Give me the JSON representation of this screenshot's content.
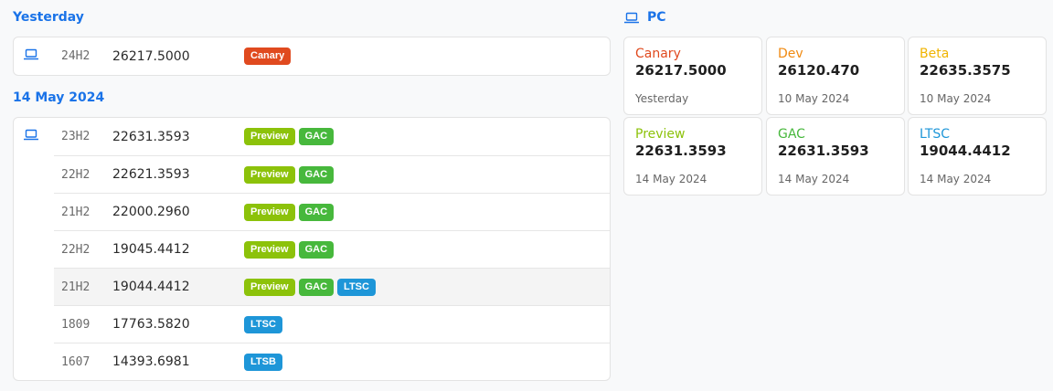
{
  "colors": {
    "accent": "#1a73e8",
    "canary": "#e04a1f",
    "dev": "#f08a11",
    "beta": "#f0b400",
    "preview": "#8cc20a",
    "gac": "#47b83c",
    "ltsc": "#1e96d8"
  },
  "sections": [
    {
      "heading": "Yesterday",
      "rows": [
        {
          "icon": "laptop-icon",
          "version": "24H2",
          "build": "26217.5000",
          "badges": [
            "Canary"
          ]
        }
      ]
    },
    {
      "heading": "14 May 2024",
      "rows": [
        {
          "icon": "laptop-icon",
          "version": "23H2",
          "build": "22631.3593",
          "badges": [
            "Preview",
            "GAC"
          ]
        },
        {
          "version": "22H2",
          "build": "22621.3593",
          "badges": [
            "Preview",
            "GAC"
          ]
        },
        {
          "version": "21H2",
          "build": "22000.2960",
          "badges": [
            "Preview",
            "GAC"
          ]
        },
        {
          "version": "22H2",
          "build": "19045.4412",
          "badges": [
            "Preview",
            "GAC"
          ]
        },
        {
          "version": "21H2",
          "build": "19044.4412",
          "badges": [
            "Preview",
            "GAC",
            "LTSC"
          ]
        },
        {
          "version": "1809",
          "build": "17763.5820",
          "badges": [
            "LTSC"
          ]
        },
        {
          "version": "1607",
          "build": "14393.6981",
          "badges": [
            "LTSB"
          ]
        }
      ]
    }
  ],
  "pc": {
    "heading": "PC",
    "icon": "laptop-icon",
    "tiles": [
      {
        "channel": "Canary",
        "build": "26217.5000",
        "date": "Yesterday",
        "color": "#e04a1f"
      },
      {
        "channel": "Dev",
        "build": "26120.470",
        "date": "10 May 2024",
        "color": "#f08a11"
      },
      {
        "channel": "Beta",
        "build": "22635.3575",
        "date": "10 May 2024",
        "color": "#f0b400"
      },
      {
        "channel": "Preview",
        "build": "22631.3593",
        "date": "14 May 2024",
        "color": "#8cc20a"
      },
      {
        "channel": "GAC",
        "build": "22631.3593",
        "date": "14 May 2024",
        "color": "#47b83c"
      },
      {
        "channel": "LTSC",
        "build": "19044.4412",
        "date": "14 May 2024",
        "color": "#1e96d8"
      }
    ]
  }
}
